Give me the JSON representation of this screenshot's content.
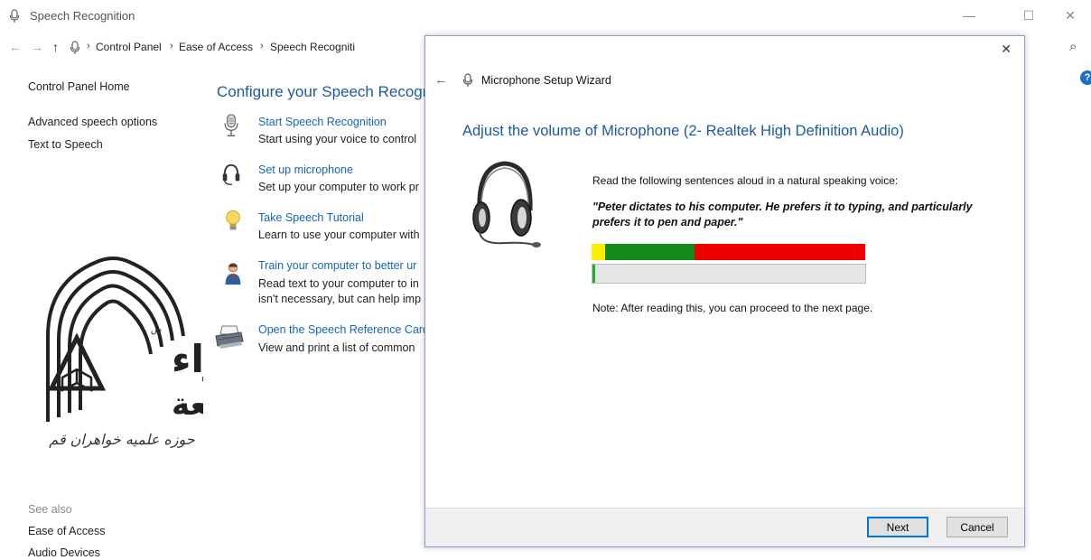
{
  "window": {
    "title": "Speech Recognition",
    "minimize_glyph": "—",
    "maximize_glyph": "☐",
    "close_glyph": "✕"
  },
  "addressbar": {
    "back_glyph": "←",
    "forward_glyph": "→",
    "up_glyph": "↑",
    "sep": "›",
    "crumbs": [
      "Control Panel",
      "Ease of Access",
      "Speech Recogniti"
    ],
    "search_glyph": "⌕"
  },
  "sidebar": {
    "home": "Control Panel Home",
    "links": [
      "Advanced speech options",
      "Text to Speech"
    ],
    "see_also_label": "See also",
    "see_also_links": [
      "Ease of Access",
      "Audio Devices"
    ]
  },
  "main": {
    "title": "Configure your Speech Recogn",
    "items": [
      {
        "link": "Start Speech Recognition",
        "desc": [
          "Start using your voice to control"
        ]
      },
      {
        "link": "Set up microphone",
        "desc": [
          "Set up your computer to work pr"
        ]
      },
      {
        "link": "Take Speech Tutorial",
        "desc": [
          "Learn to use your computer with"
        ]
      },
      {
        "link": "Train your computer to better ur",
        "desc": [
          "Read text to your computer to in",
          "isn't necessary, but can help imp"
        ]
      },
      {
        "link": "Open the Speech Reference Card",
        "desc": [
          "View and print a list of common"
        ]
      }
    ]
  },
  "dialog": {
    "title": "Microphone Setup Wizard",
    "close_glyph": "✕",
    "back_glyph": "←",
    "heading": "Adjust the volume of Microphone (2- Realtek High Definition Audio)",
    "instruction": "Read the following sentences aloud in a natural speaking voice:",
    "sentence_line1": "\"Peter dictates to his computer. He prefers it to typing, and particularly",
    "sentence_line2": "prefers it to pen and paper.\"",
    "note": "Note: After reading this, you can proceed to the next page.",
    "next_label": "Next",
    "cancel_label": "Cancel",
    "level_fraction": 0.01,
    "colors": {
      "yellow": "#ffee00",
      "green": "#138a1a",
      "red": "#ee0000",
      "level_green": "#1fae2e"
    }
  },
  "help": {
    "glyph": "?"
  },
  "logo": {
    "arabic_main": "الزهراء",
    "arabic_jamia": "جامعة",
    "arabic_sub": "حوزه علمیه خواهران قم",
    "arabic_tiny": "س"
  }
}
